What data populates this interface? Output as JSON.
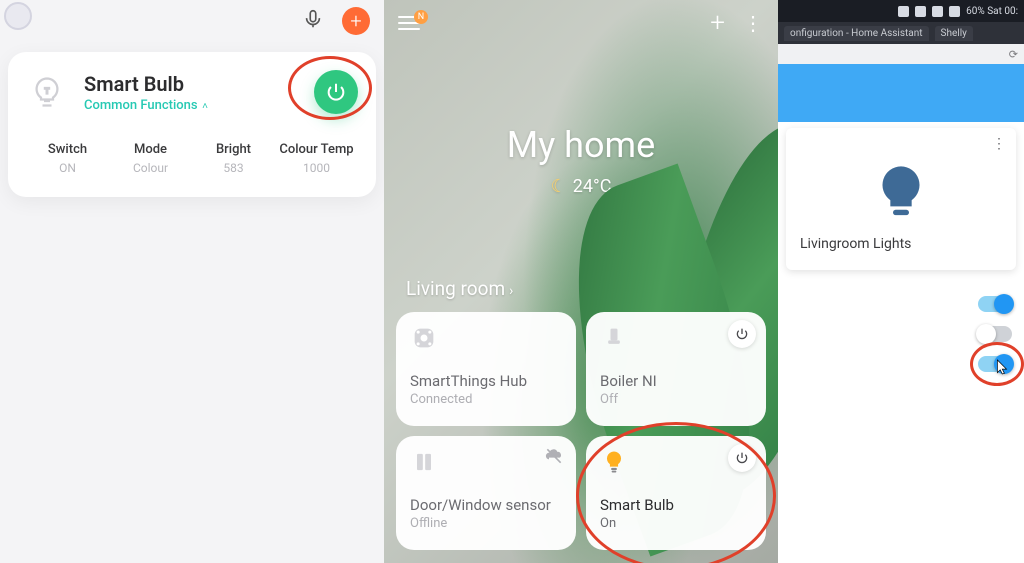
{
  "panel1": {
    "title": "Smart Bulb",
    "subtitle": "Common Functions",
    "power_on": true,
    "stats": [
      {
        "label": "Switch",
        "value": "ON"
      },
      {
        "label": "Mode",
        "value": "Colour"
      },
      {
        "label": "Bright",
        "value": "583"
      },
      {
        "label": "Colour Temp",
        "value": "1000"
      }
    ]
  },
  "panel2": {
    "menu_badge": "N",
    "title": "My home",
    "temperature": "24°C",
    "room": "Living room",
    "tiles": [
      {
        "title": "SmartThings Hub",
        "status": "Connected",
        "icon": "hub",
        "power_button": false,
        "on": false,
        "offline_badge": false
      },
      {
        "title": "Boiler NI",
        "status": "Off",
        "icon": "boiler",
        "power_button": true,
        "on": false,
        "offline_badge": false
      },
      {
        "title": "Door/Window sensor",
        "status": "Offline",
        "icon": "sensor",
        "power_button": false,
        "on": false,
        "offline_badge": true
      },
      {
        "title": "Smart Bulb",
        "status": "On",
        "icon": "bulb",
        "power_button": true,
        "on": true,
        "offline_badge": false
      }
    ]
  },
  "panel3": {
    "statusbar_text": "60%   Sat 00:",
    "tabs": [
      "onfiguration - Home Assistant",
      "Shelly"
    ],
    "refresh_glyph": "⟳",
    "card_title": "Livingroom Lights",
    "toggles": [
      {
        "on": true
      },
      {
        "on": false
      },
      {
        "on": true
      }
    ]
  }
}
